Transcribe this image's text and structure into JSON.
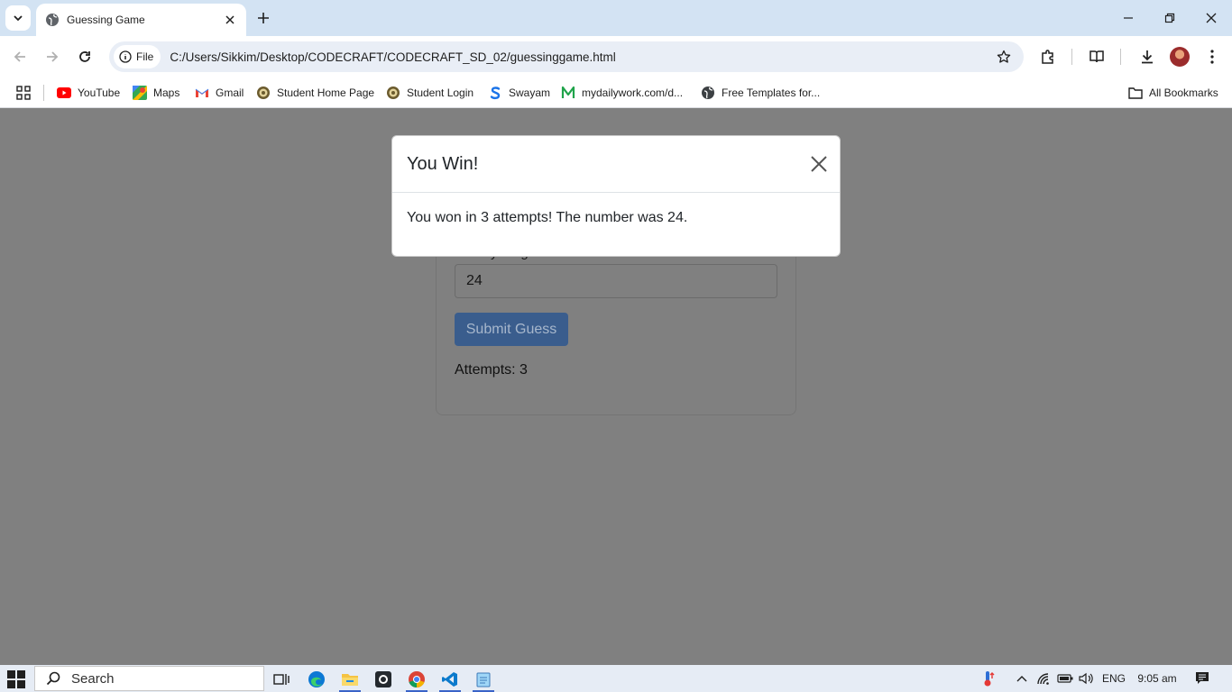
{
  "browser": {
    "tab": {
      "title": "Guessing Game"
    },
    "address": {
      "chip_label": "File",
      "url": "C:/Users/Sikkim/Desktop/CODECRAFT/CODECRAFT_SD_02/guessinggame.html"
    },
    "bookmarks": [
      {
        "label": "YouTube",
        "icon": "youtube-icon"
      },
      {
        "label": "Maps",
        "icon": "maps-icon"
      },
      {
        "label": "Gmail",
        "icon": "gmail-icon"
      },
      {
        "label": "Student Home Page",
        "icon": "college-seal-icon"
      },
      {
        "label": "Student Login",
        "icon": "college-seal-icon"
      },
      {
        "label": "Swayam",
        "icon": "swayam-icon"
      },
      {
        "label": "mydailywork.com/d...",
        "icon": "mydailywork-icon"
      },
      {
        "label": "Free Templates for...",
        "icon": "globe-icon"
      }
    ],
    "all_bookmarks_label": "All Bookmarks"
  },
  "page": {
    "guess_label": "Enter your guess:",
    "guess_value": "24",
    "submit_label": "Submit Guess",
    "attempts_text": "Attempts: 3"
  },
  "modal": {
    "title": "You Win!",
    "message": "You won in 3 attempts! The number was 24."
  },
  "taskbar": {
    "search_placeholder": "Search",
    "language": "ENG",
    "time": "9:05 am"
  },
  "colors": {
    "tabstrip": "#d3e3f3",
    "backdrop": "#808080",
    "submit_button": "#3a5d8d",
    "modal_bg": "#ffffff"
  }
}
